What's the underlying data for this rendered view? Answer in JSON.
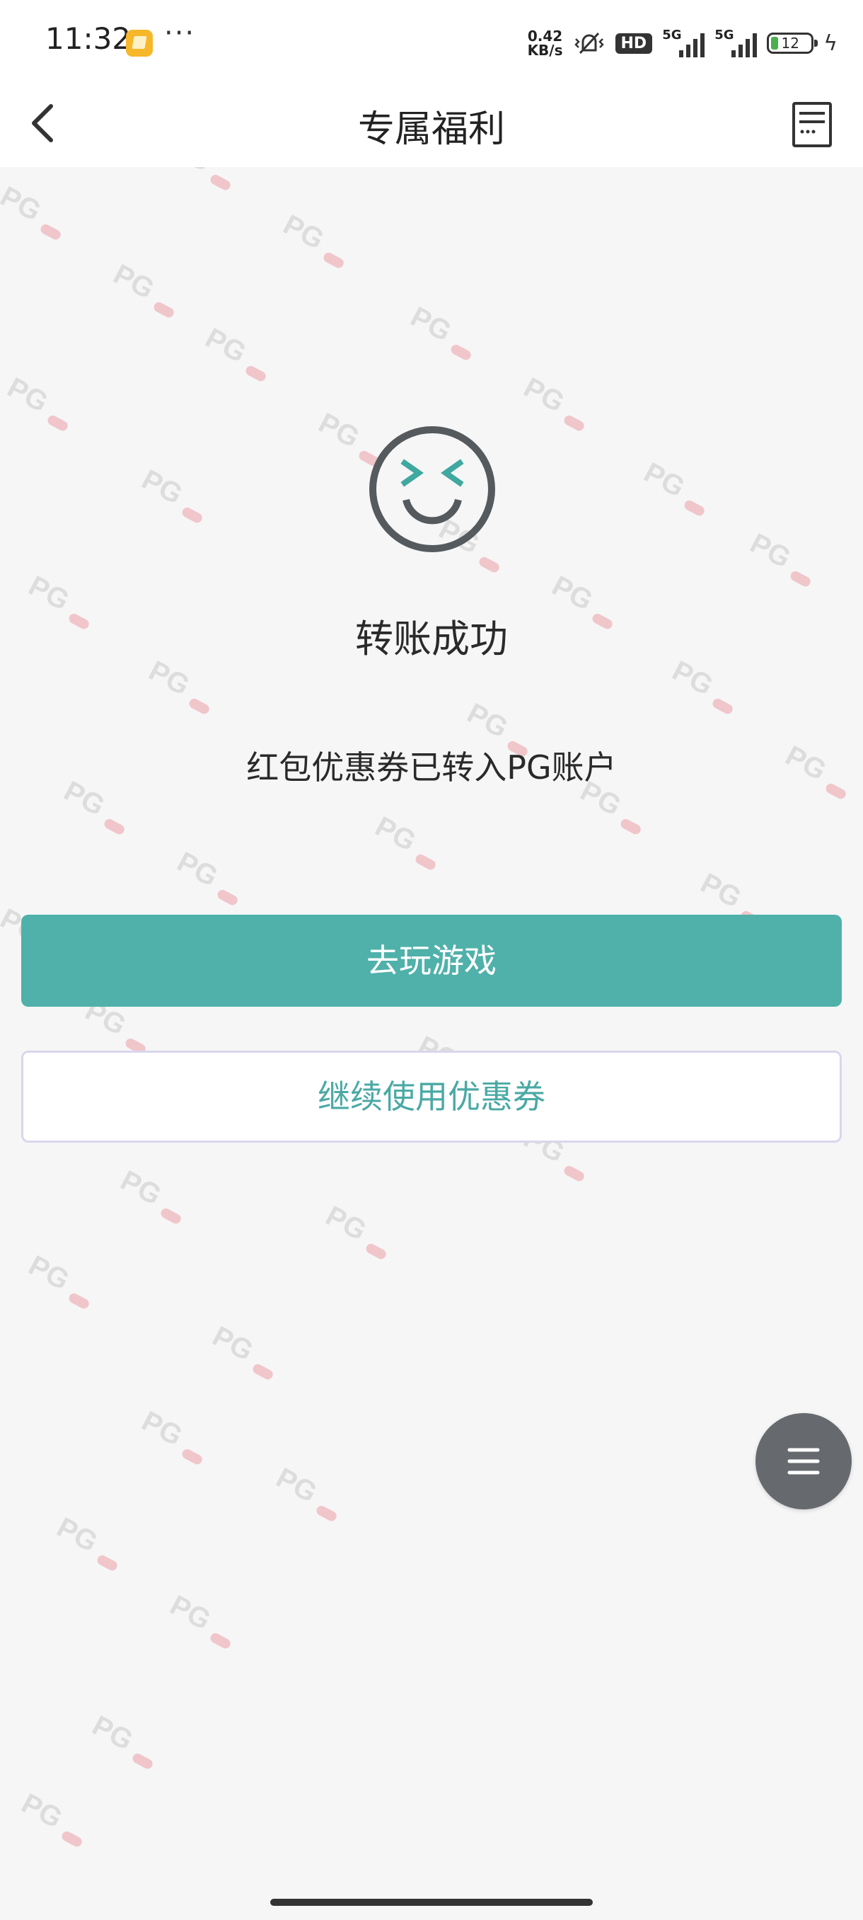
{
  "status_bar": {
    "time": "11:32",
    "more": "···",
    "net_speed_value": "0.42",
    "net_speed_unit": "KB/s",
    "hd_label": "HD",
    "signal1_label": "5G",
    "signal2_label": "5G",
    "battery_level": "12"
  },
  "header": {
    "title": "专属福利",
    "back_icon": "chevron-left-icon",
    "record_icon": "document-list-icon"
  },
  "result": {
    "icon": "smiley-face-icon",
    "title": "转账成功",
    "description": "红包优惠券已转入PG账户"
  },
  "actions": {
    "primary_label": "去玩游戏",
    "secondary_label": "继续使用优惠券"
  },
  "floating_menu": {
    "icon": "hamburger-menu-icon"
  },
  "watermark_text": "PG",
  "colors": {
    "accent": "#4fb1aa",
    "accent_text": "#4aa9a4",
    "background": "#f6f6f6",
    "fab": "#666a6e",
    "secondary_border": "#d9d6ee"
  }
}
